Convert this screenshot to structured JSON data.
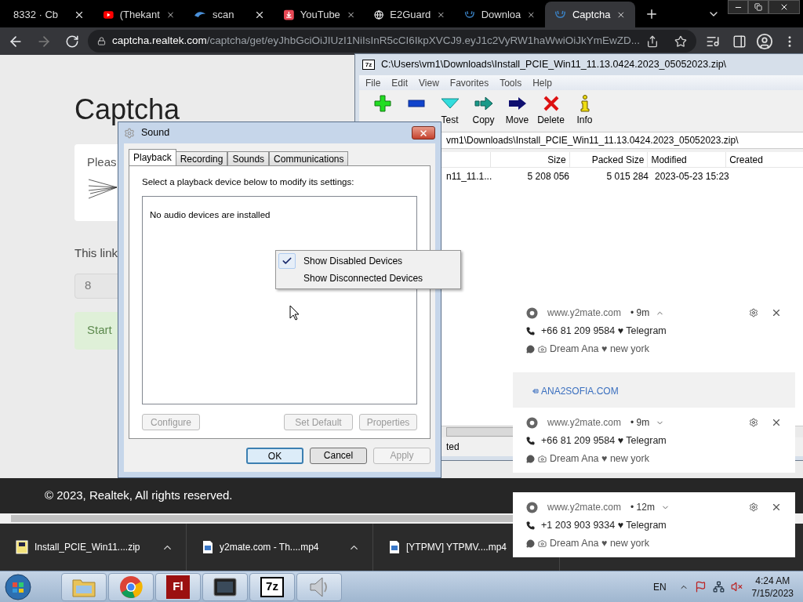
{
  "browser": {
    "tabs": [
      {
        "kind": "blank",
        "title": "8332 · Cb",
        "selected": false
      },
      {
        "kind": "youtube",
        "title": "(Thekant",
        "selected": false
      },
      {
        "kind": "scan",
        "title": "scan",
        "selected": false
      },
      {
        "kind": "download",
        "title": "YouTube",
        "selected": false
      },
      {
        "kind": "globe",
        "title": "E2Guard",
        "selected": false
      },
      {
        "kind": "realtek",
        "title": "Downloa",
        "selected": false
      },
      {
        "kind": "realtek",
        "title": "Captcha",
        "selected": true
      }
    ],
    "nav_buttons": [
      {
        "kind": "back",
        "disabled": false
      },
      {
        "kind": "forward",
        "disabled": true
      },
      {
        "kind": "reload",
        "disabled": false
      }
    ],
    "url_host": "captcha.realtek.com",
    "url_path": "/captcha/get/eyJhbGciOiJIUzI1NiIsInR5cCI6IkpXVCJ9.eyJ1c2VyRW1haWwiOiJkYmEwZD..."
  },
  "page": {
    "heading": "Captcha",
    "card_text": "Pleas",
    "link_text": "This link",
    "input_value": "8",
    "start_text": "Start",
    "footer": "© 2023, Realtek, All rights reserved."
  },
  "archiver": {
    "app_icon_label": "7z",
    "title": "C:\\Users\\vm1\\Downloads\\Install_PCIE_Win11_11.13.0424.2023_05052023.zip\\",
    "menu": [
      "File",
      "Edit",
      "View",
      "Favorites",
      "Tools",
      "Help"
    ],
    "toolbar": [
      {
        "kind": "add"
      },
      {
        "kind": "extract"
      },
      {
        "kind": "test",
        "label": "Test"
      },
      {
        "kind": "copy",
        "label": "Copy"
      },
      {
        "kind": "move",
        "label": "Move"
      },
      {
        "kind": "delete",
        "label": "Delete"
      },
      {
        "kind": "info",
        "label": "Info"
      }
    ],
    "path": "vm1\\Downloads\\Install_PCIE_Win11_11.13.0424.2023_05052023.zip\\",
    "columns": [
      "Size",
      "Packed Size",
      "Modified",
      "Created"
    ],
    "rows": [
      {
        "name": "n11_11.1...",
        "size": "5 208 056",
        "packed": "5 015 284",
        "modified": "2023-05-23 15:23"
      }
    ],
    "status": "ted"
  },
  "sound": {
    "title": "Sound",
    "tabs": [
      {
        "label": "Playback",
        "selected": true
      },
      {
        "label": "Recording",
        "selected": false
      },
      {
        "label": "Sounds",
        "selected": false
      },
      {
        "label": "Communications",
        "selected": false
      }
    ],
    "instruction": "Select a playback device below to modify its settings:",
    "empty_text": "No audio devices are installed",
    "device_buttons": [
      {
        "label": "Configure",
        "disabled": true
      },
      {
        "label": "Set Default",
        "disabled": true
      },
      {
        "label": "Properties",
        "disabled": true
      }
    ],
    "dialog_buttons": [
      {
        "label": "OK",
        "disabled": false,
        "default": true
      },
      {
        "label": "Cancel",
        "disabled": false,
        "default": false
      },
      {
        "label": "Apply",
        "disabled": true,
        "default": false
      }
    ],
    "context_menu": [
      {
        "label": "Show Disabled Devices",
        "checked": true
      },
      {
        "label": "Show Disconnected Devices",
        "checked": false
      }
    ]
  },
  "notifications": [
    {
      "site": "www.y2mate.com",
      "time": "• 9m",
      "expanded": true,
      "line1": "+66 81 209 9584 ♥ Telegram",
      "line2": "Dream Ana ♥ new york",
      "ad": "ANA2SOFIA.COM"
    },
    {
      "site": "www.y2mate.com",
      "time": "• 9m",
      "expanded": false,
      "line1": "+66 81 209 9584 ♥ Telegram",
      "line2": "Dream Ana ♥ new york"
    },
    {
      "site": "www.y2mate.com",
      "time": "• 12m",
      "expanded": false,
      "line1": "+1 203 903 9334 ♥ Telegram",
      "line2": "Dream Ana ♥ new york"
    }
  ],
  "downloads": [
    {
      "kind": "zip",
      "name": "Install_PCIE_Win11....zip"
    },
    {
      "kind": "video",
      "name": "y2mate.com - Th....mp4"
    },
    {
      "kind": "video",
      "name": "[YTPMV] YTPMV....mp4"
    }
  ],
  "taskbar": {
    "apps": [
      {
        "kind": "explorer"
      },
      {
        "kind": "chrome"
      },
      {
        "kind": "flash",
        "label": "Fl"
      },
      {
        "kind": "media"
      },
      {
        "kind": "archiver",
        "label": "7z"
      },
      {
        "kind": "sound"
      }
    ],
    "language": "EN",
    "time": "4:24 AM",
    "date": "7/15/2023"
  }
}
